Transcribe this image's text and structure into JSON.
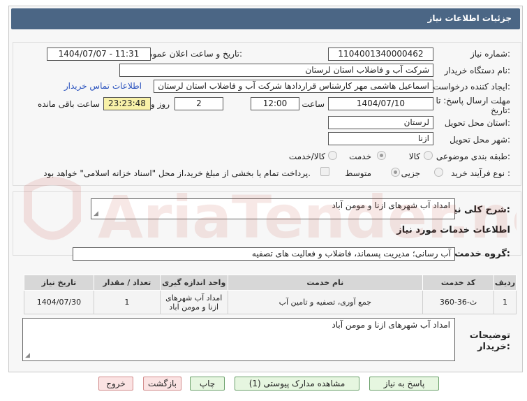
{
  "header": {
    "title": "جزئیات اطلاعات نیاز"
  },
  "form": {
    "need_number_label": "شماره نیاز:",
    "need_number": "1104001340000462",
    "announce_label": "تاریخ و ساعت اعلان عمومی:",
    "announce_value": "1404/07/07 - 11:31",
    "buyer_org_label": "نام دستگاه خریدار:",
    "buyer_org": "شرکت آب و فاضلاب استان لرستان",
    "creator_label": "ایجاد کننده درخواست:",
    "creator": "اسماعیل هاشمی مهر کارشناس قراردادها شرکت آب و فاضلاب استان لرستان",
    "contact_link": "اطلاعات تماس خریدار",
    "deadline_label_1": "مهلت ارسال پاسخ: تا",
    "deadline_label_2": "تاریخ:",
    "deadline_date": "1404/07/10",
    "time_label": "ساعت",
    "deadline_time": "12:00",
    "days_value": "2",
    "days_label": "روز و",
    "remaining_time": "23:23:48",
    "remaining_label": "ساعت باقی مانده",
    "province_label": "استان محل تحویل:",
    "province": "لرستان",
    "city_label": "شهر محل تحویل:",
    "city": "ازنا",
    "category_label": "طبقه بندی موضوعی:",
    "category_options": [
      "کالا",
      "خدمت",
      "کالا/خدمت"
    ],
    "category_selected": "خدمت",
    "process_label": "نوع فرآیند خرید :",
    "process_options": [
      "جزیی",
      "متوسط"
    ],
    "process_selected": "متوسط",
    "treasury_note": "پرداخت تمام یا بخشی از مبلغ خرید،از محل \"اسناد خزانه اسلامی\" خواهد بود."
  },
  "summary": {
    "label": "شرح کلی نیاز:",
    "value": "امداد آب شهرهای ازنا و مومن آباد"
  },
  "services": {
    "section_title": "اطلاعات خدمات مورد نیاز",
    "group_label": "گروه خدمت:",
    "group_value": "آب رسانی؛ مدیریت پسماند، فاضلاب و فعالیت های تصفیه"
  },
  "table": {
    "headers": [
      "ردیف",
      "کد خدمت",
      "نام خدمت",
      "واحد اندازه گیری",
      "تعداد / مقدار",
      "تاریخ نیاز"
    ],
    "rows": [
      [
        "1",
        "ث-36-360",
        "جمع آوری، تصفیه و تامین آب",
        "امداد آب شهرهای ازنا و مومن اباد",
        "1",
        "1404/07/30"
      ]
    ]
  },
  "buyer_notes": {
    "label_1": "توضیحات",
    "label_2": "خریدار:",
    "value": "امداد آب شهرهای ازنا و مومن آباد"
  },
  "buttons": {
    "reply": "پاسخ به نیاز",
    "attachments": "مشاهده مدارک پیوستی (1)",
    "print": "چاپ",
    "back": "بازگشت",
    "exit": "خروج"
  },
  "watermark": {
    "text": "AriaTender.neT"
  },
  "colors": {
    "header": "#4b6685",
    "accent_link": "#2a52be",
    "remaining": "#f8f1a8"
  }
}
